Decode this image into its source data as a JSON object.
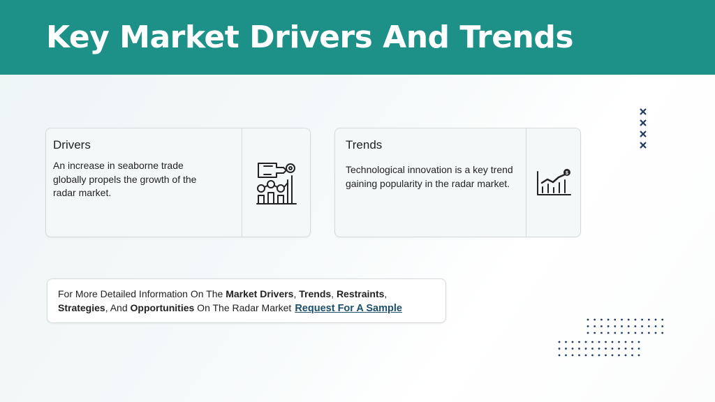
{
  "header": {
    "title": "Key Market Drivers And Trends"
  },
  "drivers": {
    "title": "Drivers",
    "body": "An increase in seaborne trade globally propels the growth of the radar market.",
    "icon": "growth-presentation-icon"
  },
  "trends": {
    "title": "Trends",
    "body": "Technological innovation is a key trend gaining popularity in the radar market.",
    "icon": "chart-growth-icon"
  },
  "cta": {
    "intro": "For More Detailed Information On The ",
    "k1": "Market Drivers",
    "sep1": ", ",
    "k2": "Trends",
    "sep2": ", ",
    "k3": "Restraints",
    "sep3": ", ",
    "k4": "Strategies",
    "sep4": ", And ",
    "k5": "Opportunities",
    "tail": " On The Radar Market",
    "link": "Request For A Sample"
  },
  "colors": {
    "header": "#1d9088",
    "link": "#1b4f6a",
    "decor": "#1e3a5f"
  }
}
